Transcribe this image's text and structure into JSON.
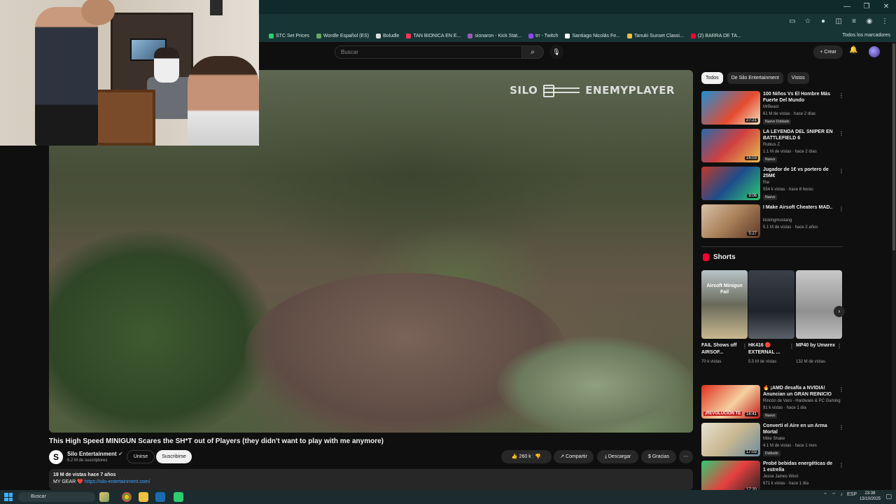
{
  "browser": {
    "bookmarks": [
      {
        "label": "STC Set Prices",
        "color": "#2ecc71"
      },
      {
        "label": "Wordle Español (ES)",
        "color": "#6aaa64"
      },
      {
        "label": "Boludle",
        "color": "#dddddd"
      },
      {
        "label": "TAN BIONICA EN E...",
        "color": "#ff3355"
      },
      {
        "label": "sionaron - Kick Stat...",
        "color": "#9b59b6"
      },
      {
        "label": "trr - Twitch",
        "color": "#9146ff"
      },
      {
        "label": "Santiago Nicolás Fe...",
        "color": "#ffffff"
      },
      {
        "label": "Tanuki Sunset Classi...",
        "color": "#f0c040"
      },
      {
        "label": "(2) BARRA DE TA...",
        "color": "#ff0033"
      }
    ],
    "all_bookmarks": "Todos los marcadores"
  },
  "header": {
    "search_placeholder": "Buscar",
    "create_label": "Crear"
  },
  "video": {
    "watermark_left": "SILO",
    "watermark_right": "ENEMYPLAYER",
    "title": "This High Speed MINIGUN Scares the SH*T out of Players (they didn't want to play with me anymore)",
    "channel": "Silo Entertainment",
    "channel_initial": "S",
    "subscribers": "6.2 M de suscriptores",
    "join_label": "Unirse",
    "subscribe_label": "Suscribirse",
    "likes": "260 k",
    "share_label": "Compartir",
    "download_label": "Descargar",
    "thanks_label": "Gracias",
    "desc_stats": "19 M de vistas  hace 7 años",
    "desc_gear_prefix": "MY GEAR ❤️",
    "desc_gear_link": "https://silo-entertainment.com/"
  },
  "sidebar": {
    "chips": [
      "Todos",
      "De Silo Entertainment",
      "Vistos"
    ],
    "recs_top": [
      {
        "title": "100 Niños Vs El Hombre Más Fuerte Del Mundo",
        "channel": "MrBeast",
        "meta": "61 M de vistas · hace 2 días",
        "badges": "Nuevo   Doblado",
        "duration": "27:21",
        "thumb": "linear-gradient(135deg,#1f8fd6,#e64a2e 60%,#f0e0c0)"
      },
      {
        "title": "LA LEYENDA DEL SNIPER EN BATTLEFIELD 6",
        "channel": "Rubius Z",
        "meta": "1.1 M de vistas · hace 2 días",
        "badges": "Nuevo",
        "duration": "16:03",
        "thumb": "linear-gradient(135deg,#2a6aa8,#d04040 50%,#e8c050)"
      },
      {
        "title": "Jugador de 1€ vs portero de 25M€",
        "channel": "Rai",
        "meta": "554 k vistas · hace 8 horas",
        "badges": "Nuevo",
        "duration": "9:06",
        "thumb": "linear-gradient(135deg,#c0392b,#1e4d8c 50%,#2ecc71)"
      },
      {
        "title": "I Make Airsoft Cheaters MAD..",
        "channel": "kickingmustang",
        "meta": "5.1 M de vistas · hace 2 años",
        "badges": "",
        "duration": "5:27",
        "thumb": "linear-gradient(135deg,#d8c0a8,#a88058 50%,#603828)"
      }
    ],
    "shorts_title": "Shorts",
    "shorts": [
      {
        "title": "FAIL Shows off AIRSOF...",
        "views": "70 k vistas",
        "overlay": "Airsoft Minigun Fail",
        "thumb": "linear-gradient(180deg,#b8c4c8,#6a6a5a 50%,#c8b890)"
      },
      {
        "title": "HK416 🔴 EXTERNAL ...",
        "views": "5.5 M de vistas",
        "overlay": "",
        "thumb": "linear-gradient(180deg,#3a4048,#20242a 60%,#5a6068)"
      },
      {
        "title": "MP40 by Umarex",
        "views": "132 M de vistas",
        "overlay": "",
        "thumb": "linear-gradient(180deg,#c8c8c8,#909090 60%,#bdbdbd)"
      }
    ],
    "recs_bottom": [
      {
        "title": "🔥 ¡AMD desafía a NVIDIA! Anuncian un GRAN REINICIO e...",
        "channel": "Rincón de Varo - Hardware & PC Gaming",
        "meta": "91 k vistas · hace 1 día",
        "badges": "Nuevo",
        "duration": "16:41",
        "overlay": "¡REVOLUCIÓN TE",
        "thumb": "linear-gradient(135deg,#e03020,#f5d0a0 55%,#c01818)"
      },
      {
        "title": "Convertí el Aire en un Arma Mortal",
        "channel": "Mike Shake",
        "meta": "4.1 M de vistas · hace 1 mes",
        "badges": "Doblado",
        "duration": "17:03",
        "overlay": "",
        "thumb": "linear-gradient(135deg,#e8e0d0,#c8b890 50%,#6a8aa0)"
      },
      {
        "title": "Probé bebidas energéticas de 1 estrella",
        "channel": "Jesse James West",
        "meta": "671 k vistas · hace 1 día",
        "badges": "",
        "duration": "17:20",
        "overlay": "",
        "thumb": "linear-gradient(135deg,#2ecc71,#e84040 50%,#202020)"
      }
    ]
  },
  "taskbar": {
    "search_label": "Buscar",
    "lang": "ESP",
    "time": "23:38",
    "date": "13/10/2025"
  }
}
